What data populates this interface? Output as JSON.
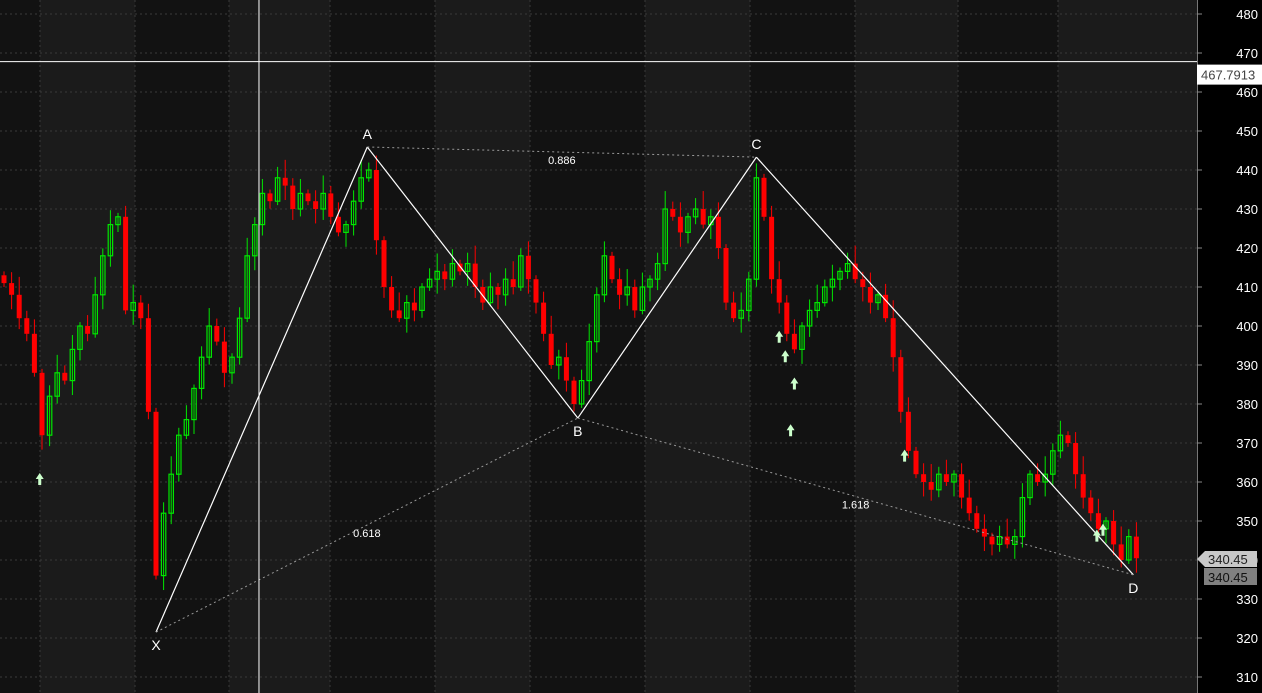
{
  "chart_data": {
    "type": "candlestick",
    "ylim": [
      307,
      484
    ],
    "yticks": [
      480,
      470,
      460,
      450,
      440,
      430,
      420,
      410,
      400,
      390,
      380,
      370,
      360,
      350,
      340,
      330,
      320,
      310
    ],
    "grid": true,
    "first_open": 413,
    "closes": [
      411,
      408,
      402,
      398,
      388,
      372,
      382,
      388,
      386,
      394,
      400,
      398,
      408,
      418,
      426,
      428,
      404,
      406,
      402,
      378,
      336,
      352,
      362,
      372,
      376,
      384,
      392,
      400,
      396,
      388,
      392,
      402,
      418,
      426,
      434,
      432,
      438,
      436,
      430,
      434,
      432,
      430,
      434,
      428,
      424,
      426,
      432,
      438,
      440,
      422,
      410,
      404,
      402,
      406,
      404,
      410,
      412,
      414,
      412,
      416,
      414,
      416,
      410,
      406,
      410,
      408,
      412,
      410,
      418,
      412,
      406,
      398,
      390,
      392,
      386,
      380,
      386,
      396,
      408,
      418,
      412,
      408,
      410,
      404,
      410,
      412,
      416,
      430,
      428,
      424,
      428,
      430,
      426,
      428,
      420,
      406,
      402,
      404,
      412,
      438,
      428,
      412,
      406,
      398,
      394,
      400,
      404,
      406,
      410,
      412,
      414,
      416,
      412,
      410,
      406,
      408,
      402,
      392,
      378,
      368,
      362,
      360,
      358,
      362,
      360,
      362,
      356,
      352,
      348,
      346,
      344,
      346,
      344,
      346,
      356,
      362,
      360,
      362,
      368,
      372,
      370,
      362,
      356,
      352,
      348,
      350,
      344,
      340,
      346,
      340.45
    ],
    "pattern": {
      "points": [
        {
          "label": "X",
          "index": 20,
          "price": 321.5
        },
        {
          "label": "A",
          "index": 47.8,
          "price": 445.9
        },
        {
          "label": "B",
          "index": 75.5,
          "price": 376.4
        },
        {
          "label": "C",
          "index": 99,
          "price": 443.3
        },
        {
          "label": "D",
          "index": 148.6,
          "price": 336.2
        }
      ],
      "ratios": [
        {
          "label": "0.886",
          "from": "A",
          "to": "C"
        },
        {
          "label": "0.618",
          "from": "X",
          "to": "B"
        },
        {
          "label": "1.618",
          "from": "B",
          "to": "D"
        }
      ]
    },
    "buy_signals": [
      [
        4.7,
        360.5
      ],
      [
        102,
        397
      ],
      [
        102.8,
        392
      ],
      [
        104,
        385
      ],
      [
        103.5,
        373
      ],
      [
        118.5,
        366.5
      ],
      [
        143.8,
        346
      ],
      [
        144.6,
        347.5
      ]
    ],
    "crosshair": {
      "index": 33.55,
      "price": 467.7913,
      "label": "467.7913"
    },
    "last_price": {
      "label": "340.45",
      "label2": "340.45",
      "value": 340.45
    },
    "colors": {
      "up": "#00e600",
      "down": "#ff0000",
      "signal": "#ccffcc",
      "pattern": "#ffffff"
    }
  }
}
